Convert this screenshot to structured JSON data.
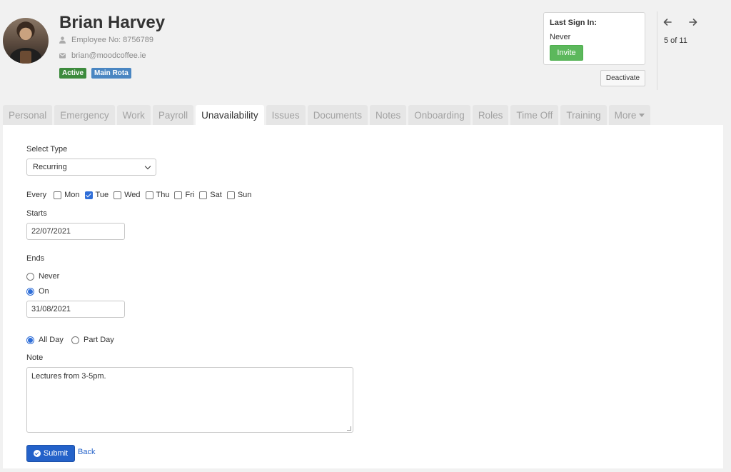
{
  "employee": {
    "name": "Brian Harvey",
    "employee_no": "Employee No: 8756789",
    "email": "brian@moodcoffee.ie",
    "badges": [
      "Active",
      "Main Rota"
    ]
  },
  "signin": {
    "title": "Last Sign In:",
    "value": "Never",
    "invite_label": "Invite"
  },
  "deactivate_label": "Deactivate",
  "pager": {
    "text": "5 of 11",
    "prev_icon": "arrow-left-icon",
    "next_icon": "arrow-right-icon"
  },
  "tabs": [
    {
      "label": "Personal"
    },
    {
      "label": "Emergency"
    },
    {
      "label": "Work"
    },
    {
      "label": "Payroll"
    },
    {
      "label": "Unavailability"
    },
    {
      "label": "Issues"
    },
    {
      "label": "Documents"
    },
    {
      "label": "Notes"
    },
    {
      "label": "Onboarding"
    },
    {
      "label": "Roles"
    },
    {
      "label": "Time Off"
    },
    {
      "label": "Training"
    },
    {
      "label": "More"
    }
  ],
  "active_tab": "Unavailability",
  "form": {
    "select_type_label": "Select Type",
    "select_type_value": "Recurring",
    "every_label": "Every",
    "days": [
      {
        "label": "Mon",
        "checked": false
      },
      {
        "label": "Tue",
        "checked": true
      },
      {
        "label": "Wed",
        "checked": false
      },
      {
        "label": "Thu",
        "checked": false
      },
      {
        "label": "Fri",
        "checked": false
      },
      {
        "label": "Sat",
        "checked": false
      },
      {
        "label": "Sun",
        "checked": false
      }
    ],
    "starts_label": "Starts",
    "starts_value": "22/07/2021",
    "ends_label": "Ends",
    "ends_never_label": "Never",
    "ends_on_label": "On",
    "ends_selected": "On",
    "ends_value": "31/08/2021",
    "all_day_label": "All Day",
    "part_day_label": "Part Day",
    "day_selected": "All Day",
    "note_label": "Note",
    "note_value": "Lectures from 3-5pm.",
    "submit_label": "Submit",
    "back_label": "Back"
  },
  "colors": {
    "accent": "#2462c9",
    "active_badge": "#3d8b3d",
    "rota_badge": "#4a86c2",
    "invite": "#5cb85c"
  }
}
